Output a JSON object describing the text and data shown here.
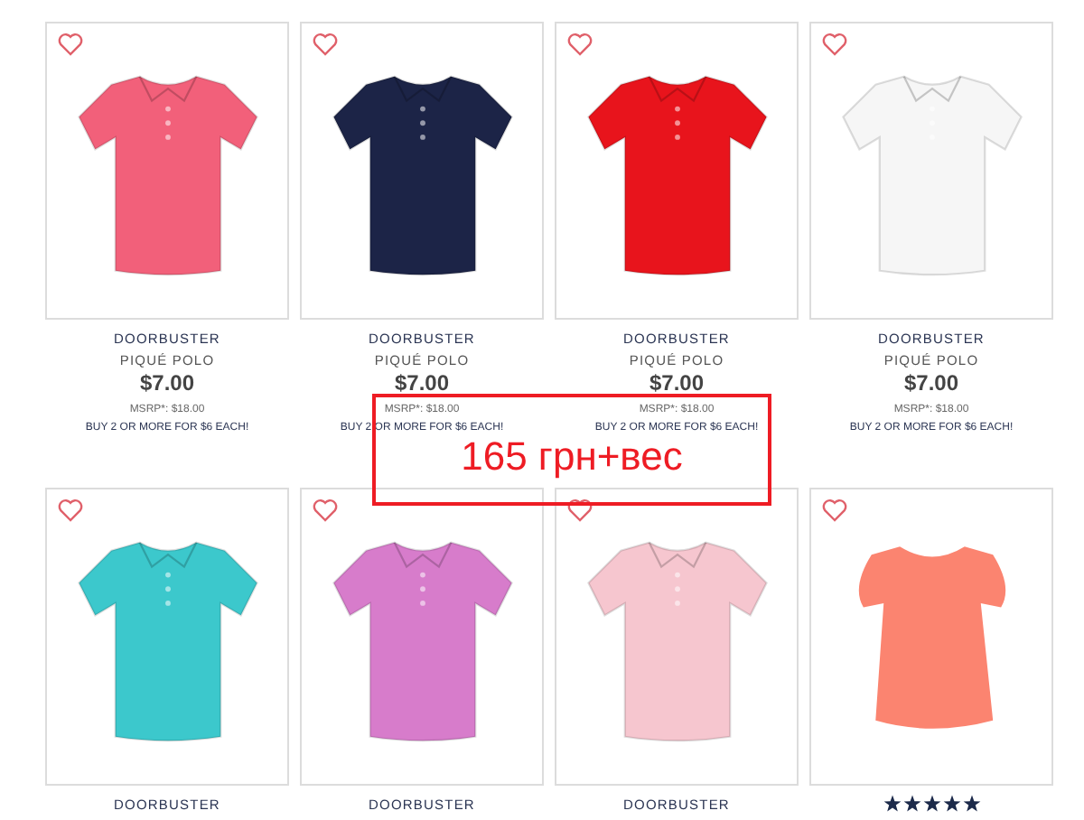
{
  "products": [
    {
      "kind": "polo",
      "color": "#f2607a",
      "favorited": false,
      "badge": "DOORBUSTER",
      "name": "PIQUÉ POLO",
      "price": "$7.00",
      "msrp": "MSRP*: $18.00",
      "promo": "BUY 2 OR MORE FOR $6 EACH!"
    },
    {
      "kind": "polo",
      "color": "#1c2447",
      "favorited": false,
      "badge": "DOORBUSTER",
      "name": "PIQUÉ POLO",
      "price": "$7.00",
      "msrp": "MSRP*: $18.00",
      "promo": "BUY 2 OR MORE FOR $6 EACH!"
    },
    {
      "kind": "polo",
      "color": "#e8141c",
      "favorited": false,
      "badge": "DOORBUSTER",
      "name": "PIQUÉ POLO",
      "price": "$7.00",
      "msrp": "MSRP*: $18.00",
      "promo": "BUY 2 OR MORE FOR $6 EACH!"
    },
    {
      "kind": "polo",
      "color": "#f6f6f6",
      "favorited": false,
      "badge": "DOORBUSTER",
      "name": "PIQUÉ POLO",
      "price": "$7.00",
      "msrp": "MSRP*: $18.00",
      "promo": "BUY 2 OR MORE FOR $6 EACH!"
    },
    {
      "kind": "polo",
      "color": "#3cc8cc",
      "favorited": false,
      "badge": "DOORBUSTER"
    },
    {
      "kind": "polo",
      "color": "#d77ccb",
      "favorited": false,
      "badge": "DOORBUSTER"
    },
    {
      "kind": "polo",
      "color": "#f6c6cf",
      "favorited": false,
      "badge": "DOORBUSTER"
    },
    {
      "kind": "top",
      "color": "#fb8470",
      "favorited": false,
      "stars": 5
    }
  ],
  "annotation": {
    "text": "165 грн+вес"
  }
}
